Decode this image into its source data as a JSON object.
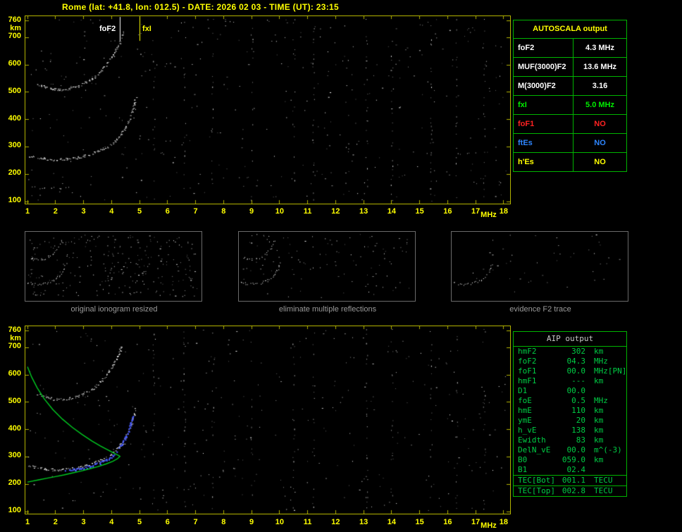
{
  "title": "Rome (lat: +41.8, lon: 012.5) - DATE: 2026 02 03 - TIME (UT): 23:15",
  "colors": {
    "background": "#000000",
    "axis": "#FFFF00",
    "frame": "#B4B400",
    "table_border": "#00B400",
    "aip_text": "#00CC44",
    "trace": "#FFFFFF",
    "profile_green": "#00CC22",
    "restored_blue": "#4A5CFF"
  },
  "autoscala_table": {
    "title": "AUTOSCALA output",
    "rows": [
      {
        "label": "foF2",
        "value": "4.3 MHz",
        "color": "#FFFFFF"
      },
      {
        "label": "MUF(3000)F2",
        "value": "13.6 MHz",
        "color": "#FFFFFF"
      },
      {
        "label": "M(3000)F2",
        "value": "3.16",
        "color": "#FFFFFF"
      },
      {
        "label": "fxI",
        "value": "5.0 MHz",
        "color": "#00EE00"
      },
      {
        "label": "foF1",
        "value": "NO",
        "color": "#FF2222"
      },
      {
        "label": "ftEs",
        "value": "NO",
        "color": "#2E86FF"
      },
      {
        "label": "h'Es",
        "value": "NO",
        "color": "#FFFF00"
      }
    ]
  },
  "aip_table": {
    "title": "AIP output",
    "rows": [
      {
        "label": "hmF2",
        "value": "302",
        "unit": "km"
      },
      {
        "label": "foF2",
        "value": "04.3",
        "unit": "MHz"
      },
      {
        "label": "foF1",
        "value": "00.0",
        "unit": "MHz",
        "note": "[PN]"
      },
      {
        "label": "hmF1",
        "value": "---",
        "unit": "km"
      },
      {
        "label": "D1",
        "value": "00.0",
        "unit": ""
      },
      {
        "label": "foE",
        "value": "0.5",
        "unit": "MHz"
      },
      {
        "label": "hmE",
        "value": "110",
        "unit": "km"
      },
      {
        "label": "ymE",
        "value": "20",
        "unit": "km"
      },
      {
        "label": "h_vE",
        "value": "138",
        "unit": "km"
      },
      {
        "label": "Ewidth",
        "value": "83",
        "unit": "km"
      },
      {
        "label": "DelN_vE",
        "value": "00.0",
        "unit": "m^(-3)"
      },
      {
        "label": "B0",
        "value": "059.0",
        "unit": "km"
      },
      {
        "label": "B1",
        "value": "02.4",
        "unit": ""
      },
      {
        "label": "TEC[Bot]",
        "value": "001.1",
        "unit": "TECU",
        "sep": true
      },
      {
        "label": "TEC[Top]",
        "value": "002.8",
        "unit": "TECU",
        "sep": true
      }
    ]
  },
  "thumbnails": [
    {
      "caption": "original ionogram resized",
      "noise_dots": 260,
      "series": [
        "low-band",
        "F2-trace",
        "F2-second-hop"
      ]
    },
    {
      "caption": "eliminate multiple reflections",
      "noise_dots": 110,
      "series": [
        "F2-trace",
        "F2-second-hop"
      ]
    },
    {
      "caption": "evidence F2 trace",
      "noise_dots": 45,
      "series": [
        "F2-trace"
      ]
    }
  ],
  "chart_data": [
    {
      "id": "main_ionogram",
      "type": "scatter",
      "title": "raw ionogram with Autoscala markers",
      "xlabel": "MHz",
      "ylabel": "km",
      "xlim": [
        1,
        18
      ],
      "ylim": [
        100,
        760
      ],
      "x_ticks": [
        1,
        2,
        3,
        4,
        5,
        6,
        7,
        8,
        9,
        10,
        11,
        12,
        13,
        14,
        15,
        16,
        17,
        18
      ],
      "y_ticks": [
        760,
        700,
        600,
        500,
        400,
        300,
        200,
        100
      ],
      "grid": false,
      "annotations": [
        {
          "label": "foF2",
          "x": 4.3,
          "color": "#FFFFFF",
          "side": "left"
        },
        {
          "label": "fxI",
          "x": 5.0,
          "color": "#FFFF00",
          "side": "right"
        }
      ],
      "noise_dots": 400,
      "interference_freqs": [
        5.5,
        6.6,
        7.6,
        9.0,
        10.5,
        11.2,
        13.1,
        14.0,
        15.4,
        16.3,
        17.3
      ],
      "series": [
        {
          "name": "F2-trace",
          "color": "#FFFFFF",
          "style": "speckle",
          "points": [
            [
              1.05,
              268
            ],
            [
              1.3,
              262
            ],
            [
              1.6,
              257
            ],
            [
              1.9,
              254
            ],
            [
              2.2,
              254
            ],
            [
              2.5,
              257
            ],
            [
              2.8,
              262
            ],
            [
              3.1,
              270
            ],
            [
              3.4,
              280
            ],
            [
              3.7,
              293
            ],
            [
              3.95,
              308
            ],
            [
              4.15,
              325
            ],
            [
              4.35,
              348
            ],
            [
              4.5,
              372
            ],
            [
              4.62,
              398
            ],
            [
              4.72,
              425
            ],
            [
              4.8,
              455
            ],
            [
              4.86,
              482
            ]
          ]
        },
        {
          "name": "F2-second-hop",
          "color": "#FFFFFF",
          "style": "speckle",
          "points": [
            [
              1.35,
              530
            ],
            [
              1.6,
              520
            ],
            [
              1.9,
              512
            ],
            [
              2.2,
              510
            ],
            [
              2.5,
              514
            ],
            [
              2.8,
              523
            ],
            [
              3.1,
              537
            ],
            [
              3.4,
              556
            ],
            [
              3.65,
              580
            ],
            [
              3.85,
              606
            ],
            [
              4.05,
              636
            ],
            [
              4.2,
              664
            ],
            [
              4.33,
              695
            ],
            [
              4.43,
              724
            ]
          ]
        },
        {
          "name": "low-band",
          "color": "#CCCCCC",
          "style": "sparse",
          "points": [
            [
              1.0,
              152
            ],
            [
              1.5,
              150
            ],
            [
              2.0,
              151
            ],
            [
              2.5,
              150
            ]
          ]
        }
      ]
    },
    {
      "id": "aip_ionogram",
      "type": "scatter",
      "title": "ionogram with restored trace and electron density profile",
      "xlabel": "MHz",
      "ylabel": "km",
      "xlim": [
        1,
        18
      ],
      "ylim": [
        100,
        760
      ],
      "x_ticks": [
        1,
        2,
        3,
        4,
        5,
        6,
        7,
        8,
        9,
        10,
        11,
        12,
        13,
        14,
        15,
        16,
        17,
        18
      ],
      "y_ticks": [
        760,
        700,
        600,
        500,
        400,
        300,
        200,
        100
      ],
      "grid": false,
      "noise_dots": 330,
      "interference_freqs": [
        5.5,
        6.6,
        7.6,
        9.0,
        10.5,
        11.2,
        13.1,
        14.0,
        15.4,
        16.3,
        17.3
      ],
      "series": [
        {
          "name": "F2-trace",
          "color": "#FFFFFF",
          "style": "speckle",
          "points": [
            [
              1.05,
              268
            ],
            [
              1.3,
              262
            ],
            [
              1.6,
              257
            ],
            [
              1.9,
              254
            ],
            [
              2.2,
              254
            ],
            [
              2.5,
              257
            ],
            [
              2.8,
              262
            ],
            [
              3.1,
              270
            ],
            [
              3.4,
              280
            ],
            [
              3.7,
              293
            ],
            [
              3.95,
              308
            ],
            [
              4.15,
              325
            ],
            [
              4.35,
              348
            ],
            [
              4.5,
              372
            ],
            [
              4.62,
              398
            ],
            [
              4.72,
              425
            ],
            [
              4.8,
              455
            ],
            [
              4.86,
              482
            ]
          ]
        },
        {
          "name": "F2-second-hop",
          "color": "#FFFFFF",
          "style": "speckle",
          "points": [
            [
              1.35,
              530
            ],
            [
              1.6,
              520
            ],
            [
              1.9,
              512
            ],
            [
              2.2,
              510
            ],
            [
              2.5,
              514
            ],
            [
              2.8,
              523
            ],
            [
              3.1,
              537
            ],
            [
              3.4,
              556
            ],
            [
              3.65,
              580
            ],
            [
              3.85,
              606
            ],
            [
              4.05,
              636
            ],
            [
              4.2,
              664
            ],
            [
              4.33,
              695
            ],
            [
              4.43,
              724
            ]
          ]
        },
        {
          "name": "restored-F2-trace",
          "color": "#4A5CFF",
          "style": "thick-speckle",
          "points": [
            [
              2.3,
              250
            ],
            [
              2.6,
              254
            ],
            [
              2.9,
              259
            ],
            [
              3.2,
              266
            ],
            [
              3.5,
              276
            ],
            [
              3.8,
              290
            ],
            [
              4.05,
              307
            ],
            [
              4.25,
              330
            ],
            [
              4.42,
              357
            ],
            [
              4.55,
              387
            ],
            [
              4.66,
              420
            ],
            [
              4.74,
              452
            ]
          ]
        },
        {
          "name": "electron-density-profile",
          "color": "#00CC22",
          "style": "line",
          "points": [
            [
              1.0,
              630
            ],
            [
              1.15,
              592
            ],
            [
              1.35,
              552
            ],
            [
              1.6,
              512
            ],
            [
              1.9,
              474
            ],
            [
              2.25,
              438
            ],
            [
              2.6,
              408
            ],
            [
              2.95,
              382
            ],
            [
              3.3,
              358
            ],
            [
              3.6,
              340
            ],
            [
              3.9,
              324
            ],
            [
              4.1,
              313
            ],
            [
              4.25,
              305
            ],
            [
              4.3,
              302
            ],
            [
              4.22,
              294
            ],
            [
              4.05,
              284
            ],
            [
              3.8,
              274
            ],
            [
              3.5,
              264
            ],
            [
              3.2,
              256
            ],
            [
              2.9,
              248
            ],
            [
              2.6,
              241
            ],
            [
              2.3,
              234
            ],
            [
              2.0,
              228
            ],
            [
              1.7,
              222
            ],
            [
              1.4,
              216
            ],
            [
              1.1,
              210
            ],
            [
              1.0,
              208
            ]
          ]
        }
      ]
    }
  ]
}
